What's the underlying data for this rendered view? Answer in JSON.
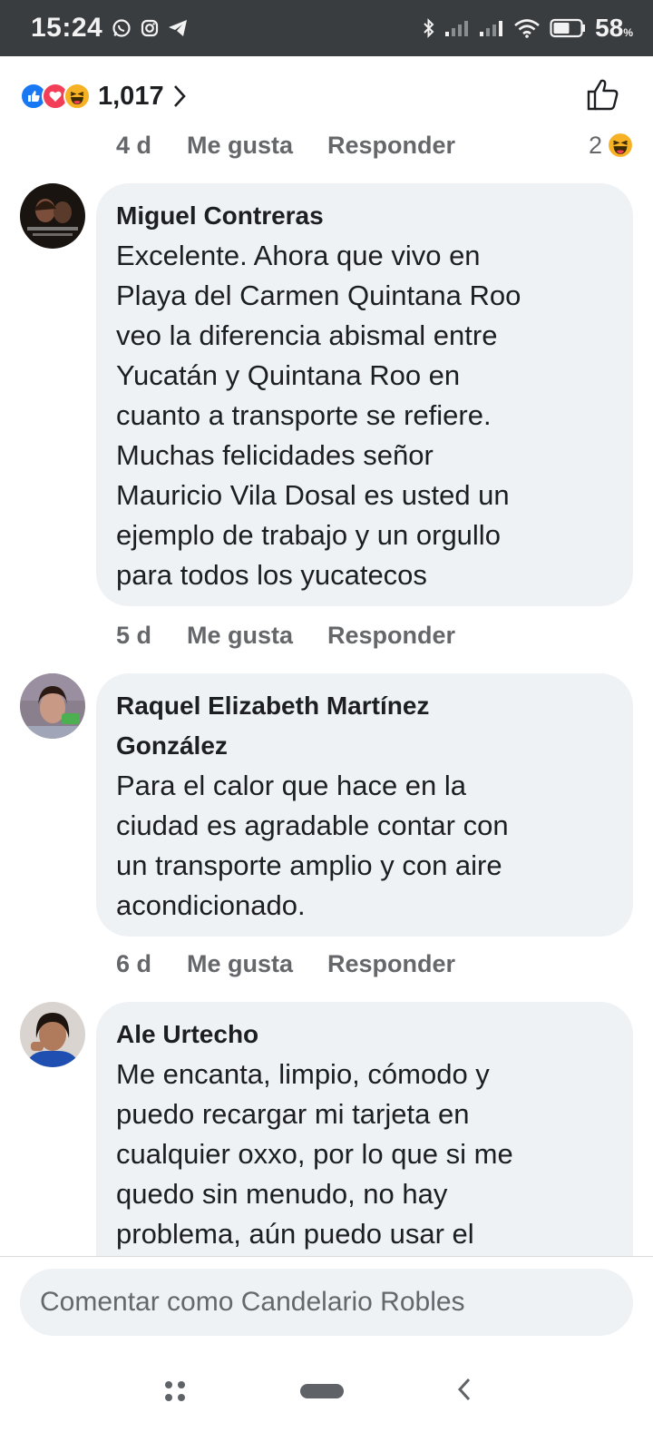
{
  "status_bar": {
    "time": "15:24",
    "battery": "58",
    "battery_unit": "%"
  },
  "reactions": {
    "count": "1,017",
    "icons": [
      "like-icon",
      "love-icon",
      "haha-icon"
    ]
  },
  "top_actions": {
    "time": "4 d",
    "like": "Me gusta",
    "reply": "Responder",
    "reaction_count": "2",
    "reaction_icon": "haha-icon"
  },
  "comments": [
    {
      "name": "Miguel Contreras",
      "lines": [
        "Excelente. Ahora que vivo en",
        "Playa del Carmen Quintana Roo",
        "veo la diferencia abismal entre",
        "Yucatán y Quintana Roo en",
        "cuanto a transporte se refiere.",
        "Muchas felicidades señor",
        "Mauricio Vila Dosal es usted un",
        "ejemplo de trabajo y un orgullo",
        "para todos los yucatecos"
      ],
      "time": "5 d",
      "like": "Me gusta",
      "reply": "Responder"
    },
    {
      "name_lines": [
        "Raquel Elizabeth Martínez",
        "González"
      ],
      "lines": [
        "Para el calor que hace en la",
        "ciudad es agradable contar con",
        "un transporte amplio y con aire",
        "acondicionado."
      ],
      "time": "6 d",
      "like": "Me gusta",
      "reply": "Responder"
    },
    {
      "name": "Ale Urtecho",
      "lines": [
        "Me encanta, limpio, cómodo y",
        "puedo recargar mi tarjeta en",
        "cualquier oxxo, por lo que si me",
        "quedo sin menudo, no hay",
        "problema, aún puedo usar el"
      ]
    }
  ],
  "comment_input": {
    "placeholder": "Comentar como Candelario Robles"
  },
  "colors": {
    "bubble": "#eff2f5",
    "meta_text": "#65676b",
    "status_bar": "#3a3d40",
    "like_blue": "#1877f2"
  }
}
